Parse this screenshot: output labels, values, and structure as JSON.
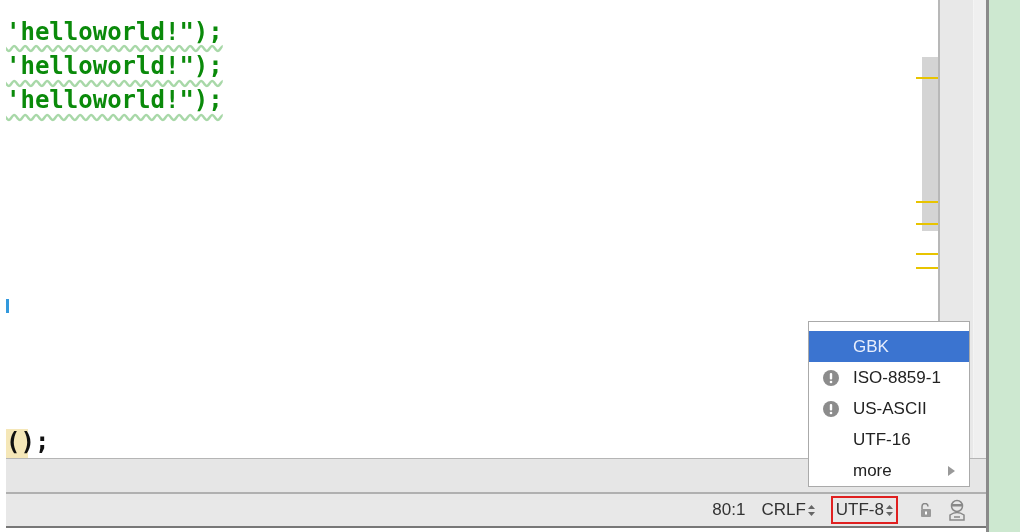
{
  "editor": {
    "lines": [
      {
        "kind": "code",
        "text": "'helloworld!\");",
        "warning": true
      },
      {
        "kind": "code",
        "text": "'helloworld!\");",
        "warning": true
      },
      {
        "kind": "code",
        "text": "'helloworld!\");",
        "warning": true
      },
      {
        "kind": "blank"
      },
      {
        "kind": "blank"
      },
      {
        "kind": "blank"
      },
      {
        "kind": "blank"
      },
      {
        "kind": "blank"
      },
      {
        "kind": "marker"
      },
      {
        "kind": "blank"
      },
      {
        "kind": "blank"
      },
      {
        "kind": "blank"
      },
      {
        "kind": "code",
        "text": "();",
        "warning": false,
        "brace_highlight": true
      }
    ]
  },
  "encoding_menu": {
    "items": [
      {
        "label": "GBK",
        "selected": true,
        "warning": false
      },
      {
        "label": "ISO-8859-1",
        "selected": false,
        "warning": true
      },
      {
        "label": "US-ASCII",
        "selected": false,
        "warning": true
      },
      {
        "label": "UTF-16",
        "selected": false,
        "warning": false
      },
      {
        "label": "more",
        "selected": false,
        "warning": false,
        "submenu": true
      }
    ]
  },
  "status_bar": {
    "position": "80:1",
    "line_separator": "CRLF",
    "encoding": "UTF-8",
    "encoding_highlighted": true
  }
}
